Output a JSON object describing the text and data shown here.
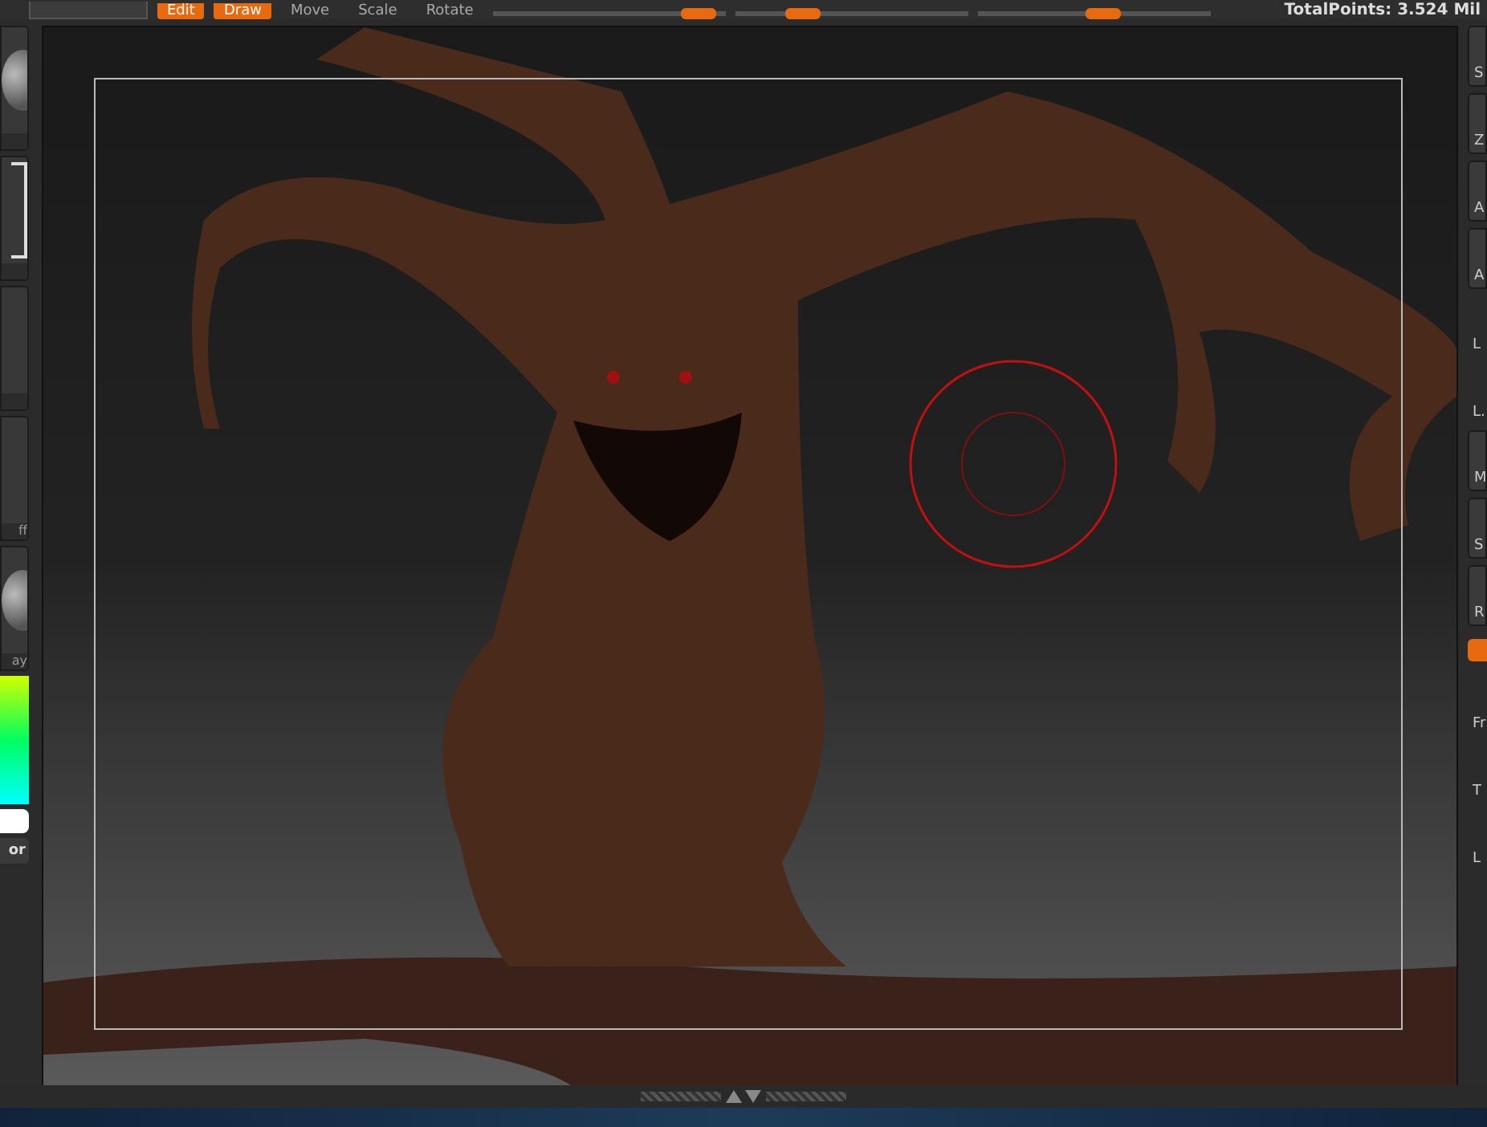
{
  "toolbar": {
    "modes": [
      {
        "label": "Edit",
        "selected": true
      },
      {
        "label": "Draw",
        "selected": true
      },
      {
        "label": "Move",
        "selected": false
      },
      {
        "label": "Scale",
        "selected": false
      },
      {
        "label": "Rotate",
        "selected": false
      }
    ],
    "sliders": [
      {
        "level": 0.95
      },
      {
        "level": 0.25
      },
      {
        "level": 0.55
      }
    ],
    "stats": "TotalPoints: 3.524 Mil"
  },
  "left_shelf": [
    {
      "kind": "sphere"
    },
    {
      "kind": "frame"
    },
    {
      "kind": "blank"
    },
    {
      "kind": "blank",
      "label": "ff"
    },
    {
      "kind": "sphere",
      "label": "ay"
    },
    {
      "kind": "color",
      "label": "or"
    }
  ],
  "right_shelf": [
    {
      "kind": "button",
      "label": "S"
    },
    {
      "kind": "button",
      "label": "Z"
    },
    {
      "kind": "button",
      "label": "A"
    },
    {
      "kind": "button",
      "label": "A"
    },
    {
      "kind": "plain",
      "label": "L"
    },
    {
      "kind": "plain",
      "label": "L."
    },
    {
      "kind": "button",
      "label": "M"
    },
    {
      "kind": "button",
      "label": "S"
    },
    {
      "kind": "button",
      "label": "R"
    },
    {
      "kind": "accent"
    },
    {
      "kind": "plain",
      "label": "Fr"
    },
    {
      "kind": "plain",
      "label": "T"
    },
    {
      "kind": "plain",
      "label": "L"
    }
  ]
}
